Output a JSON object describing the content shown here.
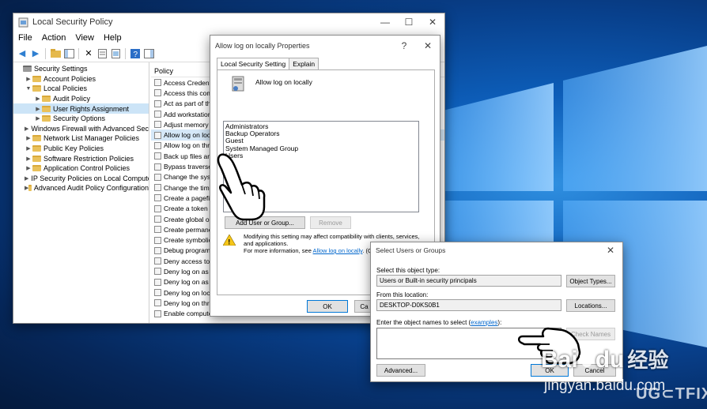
{
  "secpol": {
    "title": "Local Security Policy",
    "menu": [
      "File",
      "Action",
      "View",
      "Help"
    ],
    "tree": [
      {
        "label": "Security Settings",
        "level": 0,
        "expanded": true
      },
      {
        "label": "Account Policies",
        "level": 1,
        "expanded": false
      },
      {
        "label": "Local Policies",
        "level": 1,
        "expanded": true
      },
      {
        "label": "Audit Policy",
        "level": 2,
        "expanded": false
      },
      {
        "label": "User Rights Assignment",
        "level": 2,
        "expanded": false,
        "selected": true
      },
      {
        "label": "Security Options",
        "level": 2,
        "expanded": false
      },
      {
        "label": "Windows Firewall with Advanced Secu",
        "level": 1,
        "expanded": false
      },
      {
        "label": "Network List Manager Policies",
        "level": 1,
        "expanded": false
      },
      {
        "label": "Public Key Policies",
        "level": 1,
        "expanded": false
      },
      {
        "label": "Software Restriction Policies",
        "level": 1,
        "expanded": false
      },
      {
        "label": "Application Control Policies",
        "level": 1,
        "expanded": false
      },
      {
        "label": "IP Security Policies on Local Compute",
        "level": 1,
        "expanded": false
      },
      {
        "label": "Advanced Audit Policy Configuration",
        "level": 1,
        "expanded": false
      }
    ],
    "policy_header": "Policy",
    "policies": [
      "Access Credentia",
      "Access this comp",
      "Act as part of th",
      "Add workstation",
      "Adjust memory c",
      "Allow log on loca",
      "Allow log on thr",
      "Back up files and",
      "Bypass traverse c",
      "Change the syste",
      "Change the time",
      "Create a pagefile",
      "Create a token o",
      "Create global ob",
      "Create permaner",
      "Create symbolic",
      "Debug programs",
      "Deny access to th",
      "Deny log on as a",
      "Deny log on as a",
      "Deny log on loca",
      "Deny log on thro",
      "Enable compute"
    ],
    "selected_policy_index": 5
  },
  "props": {
    "title": "Allow log on locally Properties",
    "help_btn": "?",
    "close_btn": "✕",
    "tabs": [
      "Local Security Setting",
      "Explain"
    ],
    "policy_name": "Allow log on locally",
    "groups": [
      "Administrators",
      "Backup Operators",
      "Guest",
      "System Managed Group",
      "Users"
    ],
    "add_btn": "Add User or Group...",
    "remove_btn": "Remove",
    "warning_line1": "Modifying this setting may affect compatibility with clients, services,",
    "warning_line2": "and applications.",
    "warning_line3_pre": "For more information, see ",
    "warning_link": "Allow log on locally",
    "warning_line3_post": ". (Q8",
    "ok_btn": "OK",
    "cancel_btn": "Ca"
  },
  "selusr": {
    "title": "Select Users or Groups",
    "close_btn": "✕",
    "object_type_label": "Select this object type:",
    "object_type_value": "Users or Built-in security principals",
    "object_types_btn": "Object Types...",
    "location_label": "From this location:",
    "location_value": "DESKTOP-D0KS0B1",
    "locations_btn": "Locations...",
    "names_label_pre": "Enter the object names to select (",
    "names_label_link": "examples",
    "names_label_post": "):",
    "check_names_btn": "Check Names",
    "advanced_btn": "Advanced...",
    "ok_btn": "OK",
    "cancel_btn": "Cancel"
  },
  "watermarks": {
    "baidu_top": "Bai",
    "baidu_du": "du",
    "baidu_cn": "经验",
    "baidu_url": "jingyan.baidu.com",
    "ugetfix": "UG⊂TFIX"
  }
}
